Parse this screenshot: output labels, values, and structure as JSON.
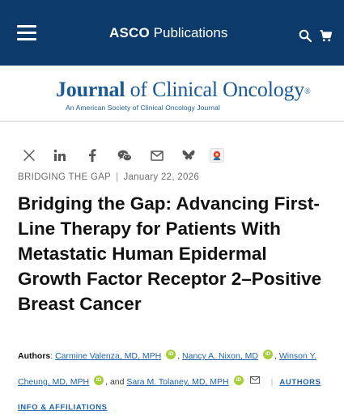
{
  "header": {
    "brand_strong": "ASCO",
    "brand_light": "Publications"
  },
  "journal": {
    "title_part1": "Journal",
    "title_part2": " of Clinical Oncology",
    "registered": "®",
    "subtitle": "An American Society of Clinical Oncology Journal"
  },
  "share_icons": [
    "x-icon",
    "linkedin-icon",
    "facebook-icon",
    "wechat-icon",
    "email-icon",
    "bluesky-icon",
    "mendeley-icon"
  ],
  "article": {
    "section": "BRIDGING THE GAP",
    "separator": "|",
    "date": "January 22, 2026",
    "title": "Bridging the Gap: Advancing First-Line Therapy for Patients With Metastatic Human Epidermal Growth Factor Receptor 2–Positive Breast Cancer"
  },
  "authors": {
    "label": "Authors",
    "colon": ": ",
    "list": [
      "Carmine Valenza, MD, MPH",
      "Nancy A. Nixon, MD",
      "Winson Y. Cheung, MD, MPH",
      "Sara M. Tolaney, MD, MPH"
    ],
    "comma": ", ",
    "and": ", and ",
    "orcid_label": "iD",
    "affiliations_link_1": "AUTHORS",
    "affiliations_link_2": "INFO & AFFILIATIONS"
  },
  "colors": {
    "header_bg": "#0b3a6b",
    "journal_blue": "#1a5a96",
    "link_blue": "#1f63ab",
    "orcid_green": "#a6ce39"
  }
}
